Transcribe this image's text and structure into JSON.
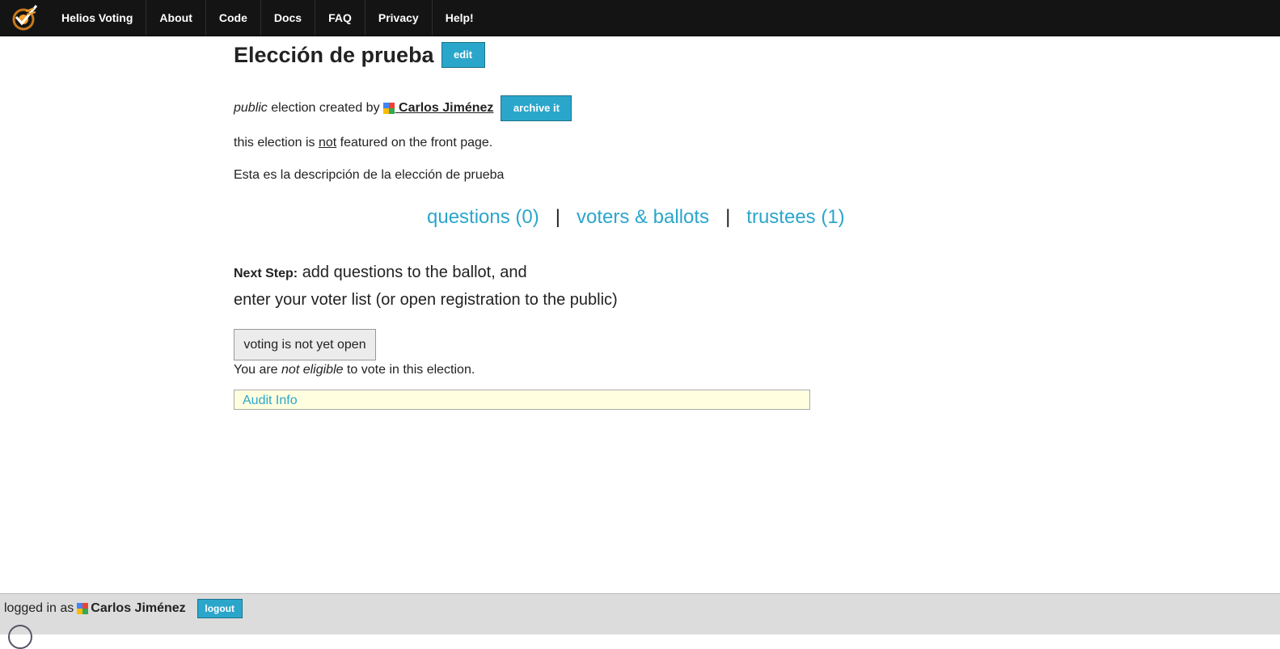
{
  "nav": {
    "logo_icon": "helios-checkmark-logo",
    "items": [
      {
        "label": "Helios Voting"
      },
      {
        "label": "About"
      },
      {
        "label": "Code"
      },
      {
        "label": "Docs"
      },
      {
        "label": "FAQ"
      },
      {
        "label": "Privacy"
      },
      {
        "label": "Help!"
      }
    ]
  },
  "election": {
    "title": "Elección de prueba",
    "edit_label": "edit",
    "visibility": "public",
    "created_by_text": "election created by",
    "creator_name": "Carlos Jiménez",
    "archive_label": "archive it",
    "featured_prefix": "this election is",
    "featured_not": "not",
    "featured_suffix": "featured on the front page.",
    "description": "Esta es la descripción de la elección de prueba"
  },
  "tabs": {
    "questions": "questions (0)",
    "separator": "|",
    "voters": "voters & ballots",
    "trustees": "trustees (1)"
  },
  "next_step": {
    "label": "Next Step:",
    "line1": "add questions to the ballot, and",
    "line2": "enter your voter list (or open registration to the public)"
  },
  "voting": {
    "button_label": "voting is not yet open",
    "eligible_prefix": "You are",
    "eligible_em": "not eligible",
    "eligible_suffix": "to vote in this election."
  },
  "audit": {
    "label": "Audit Info"
  },
  "footer": {
    "logged_in_text": "logged in as",
    "user_name": "Carlos Jiménez",
    "logout_label": "logout"
  },
  "colors": {
    "nav_bg": "#141414",
    "accent": "#2ba6cb",
    "audit_bg": "#ffffe0",
    "footer_bg": "#dcdcdc"
  }
}
